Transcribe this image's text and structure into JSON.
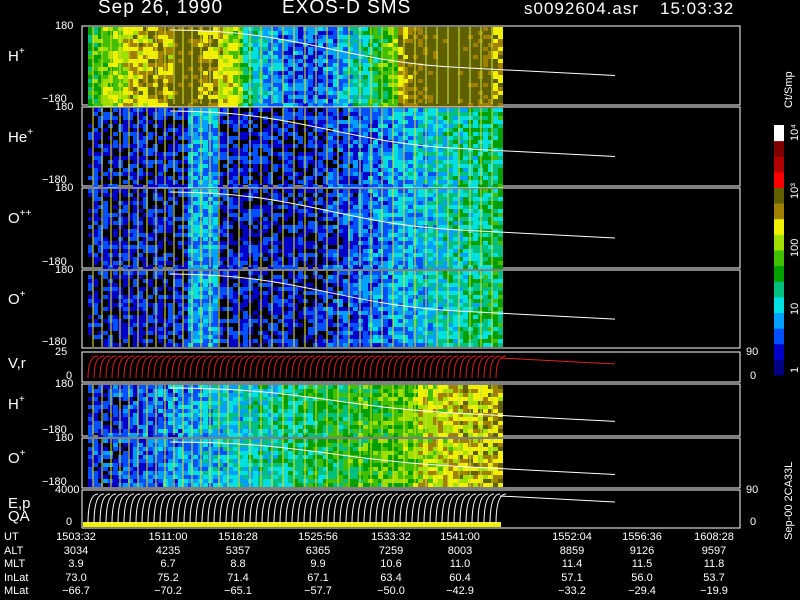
{
  "header": {
    "date": "Sep 26, 1990",
    "mission": "EXOS-D SMS",
    "file": "s0092604.asr",
    "time": "15:03:32"
  },
  "colorbar": {
    "unit": "Ct/Smp",
    "ticks": [
      {
        "label": "10⁴",
        "value": 10000
      },
      {
        "label": "10³",
        "value": 1000
      },
      {
        "label": "100",
        "value": 100
      },
      {
        "label": "10",
        "value": 10
      },
      {
        "label": "1",
        "value": 1
      }
    ],
    "colors": [
      "#000080",
      "#0000c8",
      "#0050ff",
      "#00a0ff",
      "#00e0e0",
      "#00c080",
      "#00a000",
      "#40c000",
      "#a0e000",
      "#f0f000",
      "#a08000",
      "#606000",
      "#ff0000",
      "#b00000",
      "#800000",
      "#ffffff"
    ]
  },
  "footer": {
    "side_label": "Sep-00 2CA33L"
  },
  "chart_data": {
    "type": "heatmap",
    "panels": [
      {
        "id": "H+ pitch",
        "label": "H",
        "sup": "+",
        "ymax": "180",
        "ymin": "−180"
      },
      {
        "id": "He+ pitch",
        "label": "He",
        "sup": "+",
        "ymax": "180",
        "ymin": "−180"
      },
      {
        "id": "O++ pitch",
        "label": "O",
        "sup": "++",
        "ymax": "180",
        "ymin": "−180"
      },
      {
        "id": "O+ pitch",
        "label": "O",
        "sup": "+",
        "ymax": "180",
        "ymin": "−180"
      },
      {
        "id": "V,r",
        "label": "V,r",
        "sup": "",
        "ymax": "25",
        "ymin": "0",
        "right_top": "90",
        "right_bottom": "0"
      },
      {
        "id": "H+ low",
        "label": "H",
        "sup": "+",
        "ymax": "180",
        "ymin": "−180"
      },
      {
        "id": "O+ low",
        "label": "O",
        "sup": "+",
        "ymax": "180",
        "ymin": "−180"
      },
      {
        "id": "E,p QA",
        "label": "E,p",
        "label2": "QA",
        "sup": "",
        "ymax": "4000",
        "ymin": "0",
        "right_top": "90",
        "right_bottom": "0"
      }
    ],
    "rows": [
      {
        "name": "UT",
        "values": [
          "1503:32",
          "1511:00",
          "1518:28",
          "1525:56",
          "1533:32",
          "1541:00",
          "1552:04",
          "1556:36",
          "1608:28"
        ]
      },
      {
        "name": "ALT",
        "values": [
          "3034",
          "4235",
          "5357",
          "6365",
          "7259",
          "8003",
          "8859",
          "9126",
          "9597"
        ]
      },
      {
        "name": "MLT",
        "values": [
          "3.9",
          "6.7",
          "8.8",
          "9.9",
          "10.6",
          "11.0",
          "11.4",
          "11.5",
          "11.8"
        ]
      },
      {
        "name": "InLat",
        "values": [
          "73.0",
          "75.2",
          "71.4",
          "67.1",
          "63.4",
          "60.4",
          "57.1",
          "56.0",
          "53.7"
        ]
      },
      {
        "name": "MLat",
        "values": [
          "−66.7",
          "−70.2",
          "−65.1",
          "−57.7",
          "−50.0",
          "−42.9",
          "−33.2",
          "−29.4",
          "−19.9"
        ]
      }
    ]
  }
}
